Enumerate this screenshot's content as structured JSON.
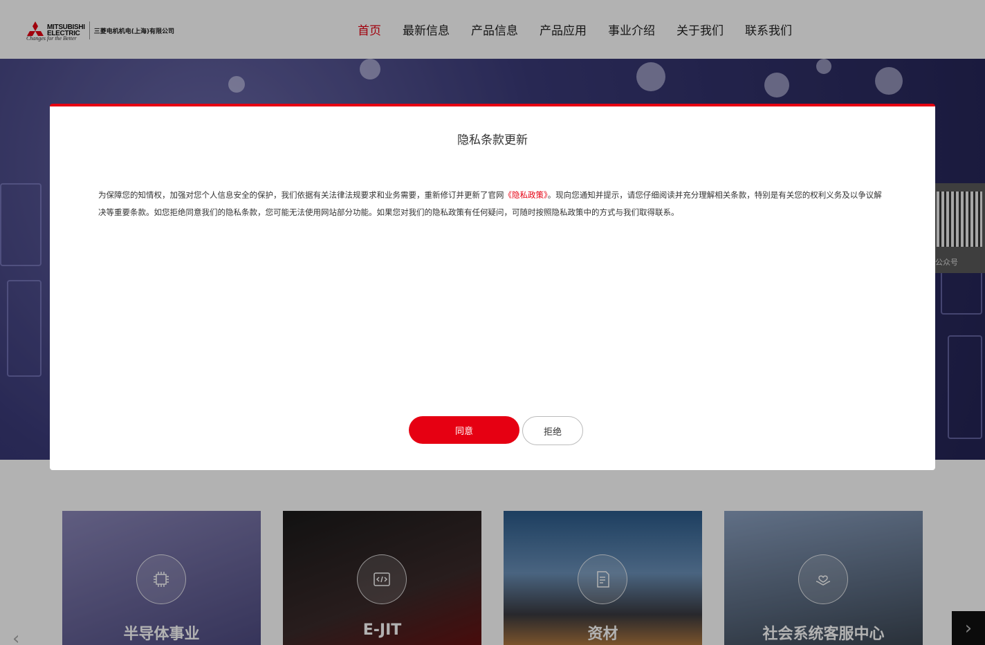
{
  "header": {
    "brand_line1": "MITSUBISHI",
    "brand_line2": "ELECTRIC",
    "tagline": "Changes for the Better",
    "company": "三菱电机机电(上海)有限公司",
    "accent_color": "#e60012",
    "nav": [
      {
        "label": "首页",
        "active": true
      },
      {
        "label": "最新信息"
      },
      {
        "label": "产品信息"
      },
      {
        "label": "产品应用"
      },
      {
        "label": "事业介绍"
      },
      {
        "label": "关于我们"
      },
      {
        "label": "联系我们"
      }
    ]
  },
  "side_panel": {
    "qr_label": "公众号"
  },
  "cards": [
    {
      "title": "半导体事业",
      "icon": "chip-icon"
    },
    {
      "title": "E-JIT",
      "icon": "code-icon"
    },
    {
      "title": "资材",
      "icon": "document-icon"
    },
    {
      "title": "社会系统客服中心",
      "icon": "care-hands-icon"
    }
  ],
  "carousel": {
    "prev_glyph": "‹",
    "next_glyph": "›"
  },
  "modal": {
    "title": "隐私条款更新",
    "body_before": "为保障您的知情权，加强对您个人信息安全的保护，我们依据有关法律法规要求和业务需要，重新修订并更新了官网",
    "policy_link": "《隐私政策》",
    "body_after": "。现向您通知并提示，请您仔细阅读并充分理解相关条款，特别是有关您的权利义务及以争议解决等重要条款。如您拒绝同意我们的隐私条款，您可能无法使用网站部分功能。如果您对我们的隐私政策有任何疑问，可随时按照隐私政策中的方式与我们取得联系。",
    "agree_label": "同意",
    "refuse_label": "拒绝"
  }
}
